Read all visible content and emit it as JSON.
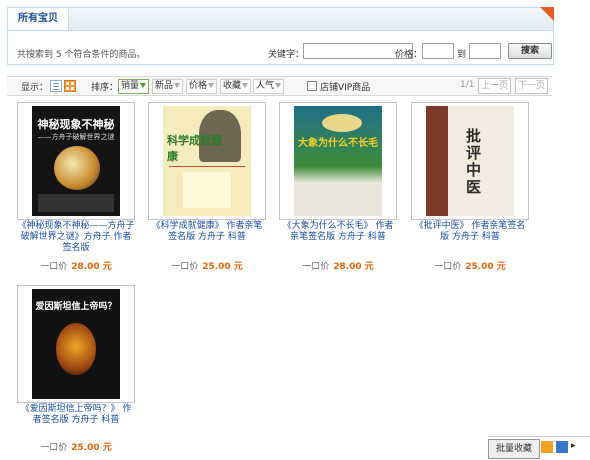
{
  "panel": {
    "tab_title": "所有宝贝",
    "summary": "共搜索到 5 个符合条件的商品。",
    "keyword_label": "关键字：",
    "keyword_value": "",
    "price_label": "价格：",
    "to_label": "到",
    "price_min": "",
    "price_max": "",
    "search_button": "搜索"
  },
  "sortbar": {
    "display_label": "显示：",
    "sort_label": "排序：",
    "sort_options": [
      "销量",
      "新品",
      "价格",
      "收藏",
      "人气"
    ],
    "active_sort": "销量",
    "vip_label": "店铺VIP商品",
    "page_count": "1/1",
    "prev_page": "上一页",
    "next_page": "下一页"
  },
  "products": [
    {
      "title": "《神秘现象不神秘——方舟子破解世界之谜》方舟子 作者签名版",
      "price_label": "一口价",
      "price": "28.00 元",
      "cover_title": "神秘现象不神秘",
      "cover_subtitle": "——方舟子破解世界之谜",
      "cover_color": "#1a1a1a"
    },
    {
      "title": "《科学成就健康》 作者亲笔签名版 方舟子 科普",
      "price_label": "一口价",
      "price": "25.00 元",
      "cover_title": "科学成就健康",
      "cover_subtitle": "",
      "cover_color": "#f3e9b8"
    },
    {
      "title": "《大象为什么不长毛》 作者亲笔签名版 方舟子 科普",
      "price_label": "一口价",
      "price": "28.00 元",
      "cover_title": "大象为什么不长毛",
      "cover_subtitle": "",
      "cover_color": "#3f7f3a"
    },
    {
      "title": "《批评中医》 作者亲笔签名版 方舟子 科普",
      "price_label": "一口价",
      "price": "25.00 元",
      "cover_title": "批评中医",
      "cover_subtitle": "",
      "cover_color": "#efe8dc"
    },
    {
      "title": "《爱因斯坦信上帝吗？》 作者签名版 方舟子 科普",
      "price_label": "一口价",
      "price": "25.00 元",
      "cover_title": "爱因斯坦信上帝吗？",
      "cover_subtitle": "",
      "cover_color": "#1a1a1a"
    }
  ],
  "floating_bar": {
    "button_label": "批量收藏"
  },
  "colors": {
    "link": "#1a4ea3",
    "price": "#e2660c",
    "accent": "#e95b1e"
  }
}
